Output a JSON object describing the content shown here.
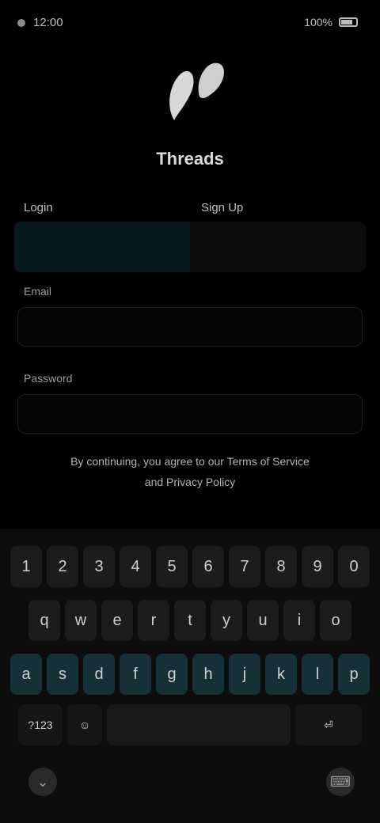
{
  "status": {
    "time": "12:00",
    "battery": "100%"
  },
  "app": {
    "name": "Threads"
  },
  "tabs": [
    {
      "label": "Login"
    },
    {
      "label": "Sign Up"
    }
  ],
  "form": {
    "email_label": "Email",
    "email_value": "",
    "password_label": "Password",
    "password_value": ""
  },
  "terms": {
    "line1": "By continuing, you agree to our Terms of Service",
    "line2": "and Privacy Policy"
  },
  "keyboard": {
    "row1": [
      "1",
      "2",
      "3",
      "4",
      "5",
      "6",
      "7",
      "8",
      "9",
      "0"
    ],
    "row2": [
      "q",
      "w",
      "e",
      "r",
      "t",
      "y",
      "u",
      "i",
      "o"
    ],
    "row3": [
      "a",
      "s",
      "d",
      "f",
      "g",
      "h",
      "j",
      "k",
      "l",
      "p"
    ],
    "row4_left": "?123",
    "row4_emoji": "☺",
    "row4_space": "",
    "row4_right": "⏎"
  },
  "nav": {
    "back_icon": "back-icon",
    "keyboard_icon": "keyboard-icon"
  }
}
